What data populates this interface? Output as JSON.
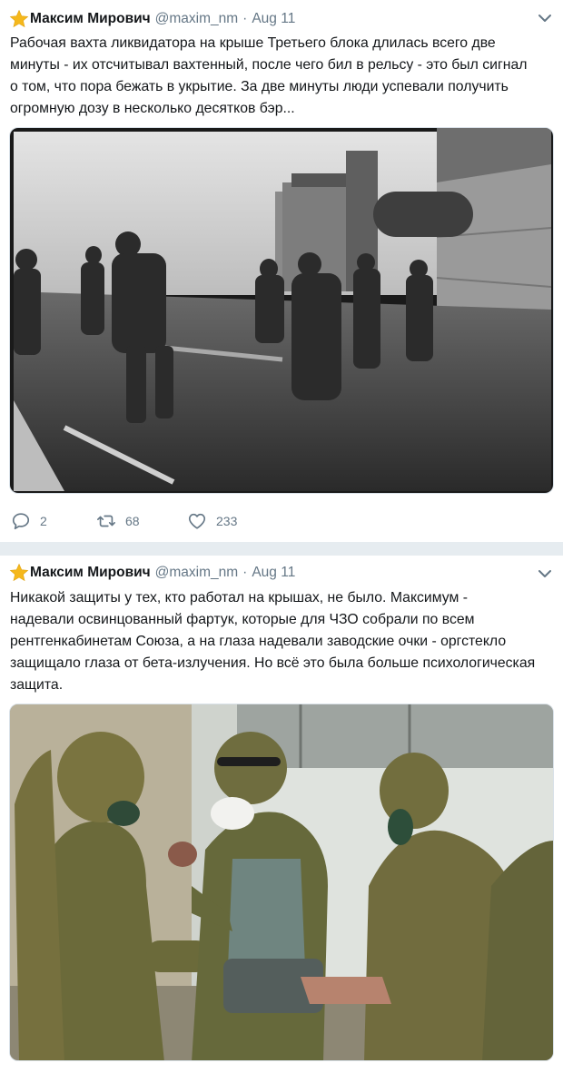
{
  "tweets": [
    {
      "author_name": "Максим Мирович",
      "handle": "@maxim_nm",
      "separator": "·",
      "date": "Aug 11",
      "text_lines": [
        "Рабочая вахта ликвидатора на крыше Третьего блока длилась всего две",
        "минуты - их отсчитывал вахтенный, после чего бил в рельсу - это был сигнал",
        "о том, что пора бежать в укрытие. За две минуты люди успевали получить",
        "огромную дозу в несколько десятков бэр..."
      ],
      "replies": "2",
      "retweets": "68",
      "likes": "233"
    },
    {
      "author_name": "Максим Мирович",
      "handle": "@maxim_nm",
      "separator": "·",
      "date": "Aug 11",
      "text_lines": [
        "Никакой защиты у тех, кто работал на крышах, не было. Максимум -",
        "надевали освинцованный фартук, которые для ЧЗО собрали по всем",
        "рентгенкабинетам Союза, а на глаза надевали заводские очки - оргстекло",
        "защищало глаза от бета-излучения. Но всё это была больше психологическая",
        "защита."
      ]
    }
  ],
  "colors": {
    "star": "#f5b81c",
    "secondary_text": "#657786",
    "separator": "#e6ecf0",
    "photo_bw_sky": "#cfcfcf",
    "photo_color_wall": "#d8dcd6",
    "protective_suit": "#6b6a3a"
  },
  "icons": {
    "star": "star-icon",
    "caret": "chevron-down-icon",
    "reply": "reply-icon",
    "retweet": "retweet-icon",
    "like": "heart-icon"
  }
}
